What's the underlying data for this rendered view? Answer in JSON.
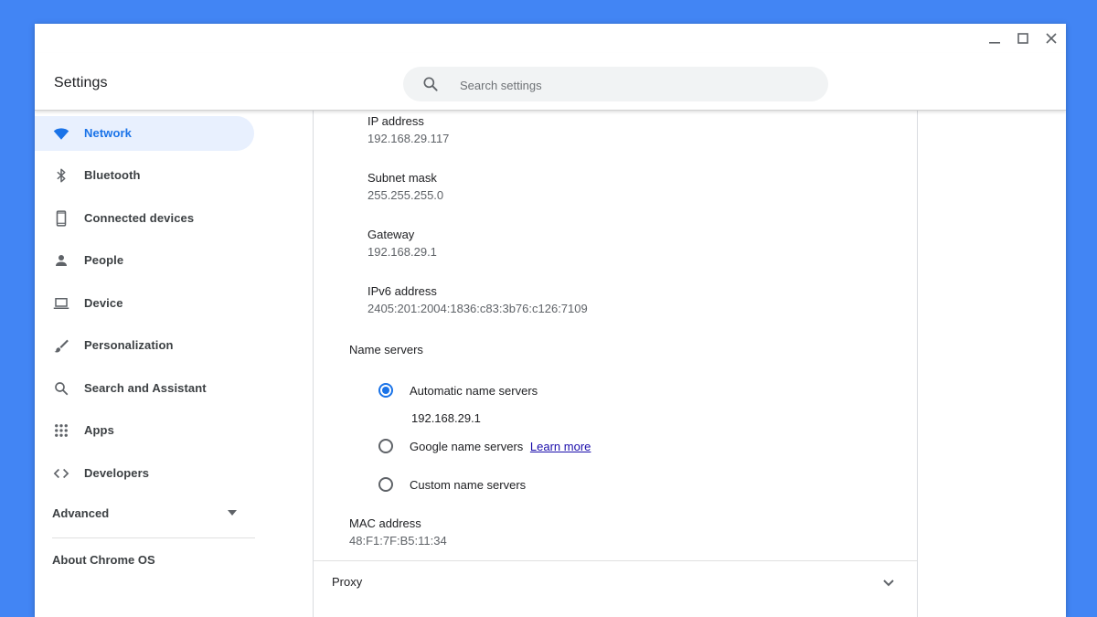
{
  "app": {
    "title": "Settings"
  },
  "search": {
    "placeholder": "Search settings"
  },
  "sidebar": {
    "items": [
      {
        "label": "Network",
        "icon": "wifi-icon",
        "active": true
      },
      {
        "label": "Bluetooth",
        "icon": "bluetooth-icon"
      },
      {
        "label": "Connected devices",
        "icon": "phone-icon"
      },
      {
        "label": "People",
        "icon": "person-icon"
      },
      {
        "label": "Device",
        "icon": "laptop-icon"
      },
      {
        "label": "Personalization",
        "icon": "brush-icon"
      },
      {
        "label": "Search and Assistant",
        "icon": "search-icon"
      },
      {
        "label": "Apps",
        "icon": "apps-grid-icon"
      },
      {
        "label": "Developers",
        "icon": "code-icon"
      }
    ],
    "advanced_label": "Advanced",
    "about_label": "About Chrome OS"
  },
  "network": {
    "ip": {
      "label": "IP address",
      "value": "192.168.29.117"
    },
    "subnet": {
      "label": "Subnet mask",
      "value": "255.255.255.0"
    },
    "gateway": {
      "label": "Gateway",
      "value": "192.168.29.1"
    },
    "ipv6": {
      "label": "IPv6 address",
      "value": "2405:201:2004:1836:c83:3b76:c126:7109"
    },
    "name_servers": {
      "label": "Name servers",
      "options": [
        {
          "label": "Automatic name servers",
          "checked": true,
          "detail": "192.168.29.1"
        },
        {
          "label": "Google name servers",
          "checked": false,
          "link": "Learn more"
        },
        {
          "label": "Custom name servers",
          "checked": false
        }
      ]
    },
    "mac": {
      "label": "MAC address",
      "value": "48:F1:7F:B5:11:34"
    },
    "proxy_label": "Proxy"
  },
  "colors": {
    "background": "#4285f4",
    "accent": "#1a73e8",
    "active_nav_bg": "#e8f0fe",
    "link": "#1a0dab"
  }
}
